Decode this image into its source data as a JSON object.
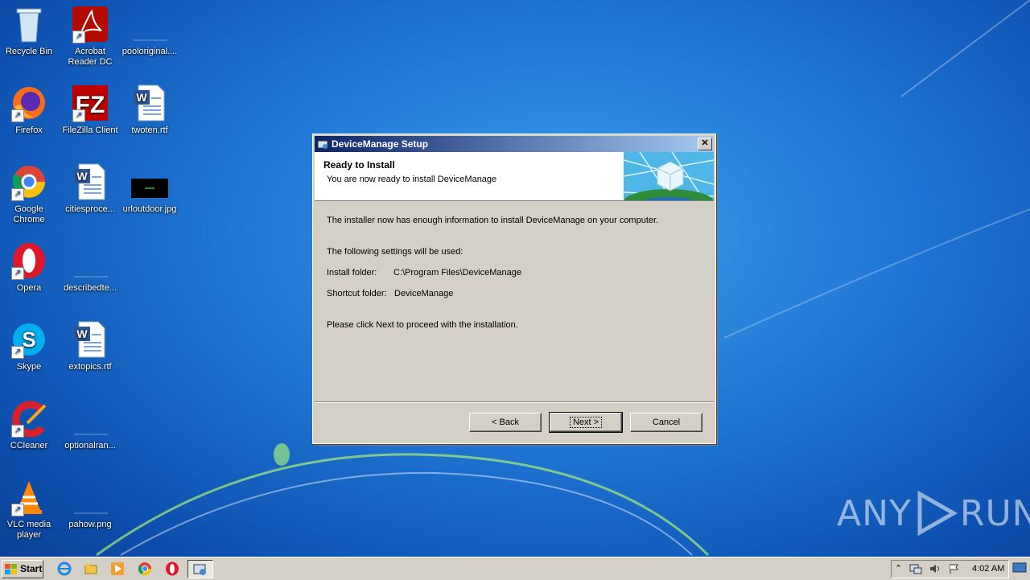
{
  "desktop_icons": [
    {
      "label": "Recycle Bin"
    },
    {
      "label": "Acrobat Reader DC"
    },
    {
      "label": "pooloriginal...."
    },
    {
      "label": "Firefox"
    },
    {
      "label": "FileZilla Client"
    },
    {
      "label": "twoten.rtf"
    },
    {
      "label": "Google Chrome"
    },
    {
      "label": "citiesproce..."
    },
    {
      "label": "urloutdoor.jpg"
    },
    {
      "label": "Opera"
    },
    {
      "label": "describedte..."
    },
    {
      "label": "Skype"
    },
    {
      "label": "extopics.rtf"
    },
    {
      "label": "CCleaner"
    },
    {
      "label": "optionalran..."
    },
    {
      "label": "VLC media player"
    },
    {
      "label": "pahow.png"
    }
  ],
  "dialog": {
    "title": "DeviceManage Setup",
    "close_glyph": "✕",
    "header_title": "Ready to Install",
    "header_subtitle": "You are now ready to install DeviceManage",
    "line1": "The installer now has enough information to install DeviceManage on your computer.",
    "line2": "The following settings will be used:",
    "install_folder_label": "Install folder:",
    "install_folder_value": "C:\\Program Files\\DeviceManage",
    "shortcut_folder_label": "Shortcut folder:",
    "shortcut_folder_value": "DeviceManage",
    "line3": "Please click Next to proceed with the installation.",
    "buttons": {
      "back": "< Back",
      "next": "Next >",
      "cancel": "Cancel"
    }
  },
  "taskbar": {
    "start_label": "Start",
    "clock": "4:02 AM"
  },
  "watermark": {
    "left": "ANY",
    "right": "RUN"
  },
  "colors": {
    "titlebar": "#0a246a",
    "dialog_bg": "#d4d0c8",
    "desktop": "#1e74d2"
  }
}
